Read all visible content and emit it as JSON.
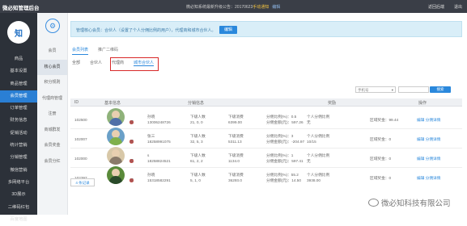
{
  "app": {
    "title": "微必知管理后台"
  },
  "topbar": {
    "message": "微必知系统最新升级公告：20170623",
    "highlight": "手动通知",
    "edit": "编辑",
    "links": [
      "返回后端",
      "退出"
    ]
  },
  "logo_text": "知",
  "nav1": [
    "商品",
    "基本设置",
    "商品管理",
    "会员管理",
    "订单管理",
    "财务信息",
    "促销活动",
    "统计营销",
    "分销管理",
    "微信营销",
    "多网络平台",
    "3D展示",
    "二维码红包",
    "百度地图",
    "支付宝分销"
  ],
  "nav2": [
    "会员",
    "核心会员",
    "积分规则",
    "代理商管理",
    "注册",
    "商城群发",
    "会员奖金",
    "会员分红"
  ],
  "alert": {
    "text": "管理核心会员：合伙人（设置了个人分佣比例的用户），代理商和城市合伙人。",
    "button": "编辑"
  },
  "tabs1": [
    "会员列表",
    "推广二维码"
  ],
  "tabs2": [
    "全部",
    "合伙人",
    "代理商",
    "城市合伙人"
  ],
  "filter": {
    "select": "手机号",
    "button": "搜索"
  },
  "table": {
    "headers": [
      "ID",
      "基本信息",
      "分销信息",
      "奖励",
      "操作"
    ],
    "rows": [
      {
        "id": "102500",
        "name": "孙晓",
        "phone": "13006248726",
        "sub_a": "下级人数",
        "sub_a_val": "21, 0, 0",
        "sub_b": "下级消费",
        "sub_b_val": "6399.00",
        "r1": "分佣比例(%)：0.5",
        "r1b": "个人分佣比例",
        "r2": "分佣金额(元)：597.26",
        "r2b": "无",
        "extra": "区域奖金：99.44",
        "op": "编辑  分佣详情"
      },
      {
        "id": "102007",
        "name": "张三",
        "phone": "18258991075",
        "sub_a": "下级人数",
        "sub_a_val": "32, 5, 3",
        "sub_b": "下级消费",
        "sub_b_val": "5311.13",
        "r1": "分佣比例(%)：3",
        "r1b": "个人分佣比例",
        "r2": "分佣金额(元)：-204.97",
        "r2b": "10/15",
        "extra": "区域奖金：0",
        "op": "编辑  分佣详情"
      },
      {
        "id": "102000",
        "name": "s",
        "phone": "18258824521",
        "sub_a": "下级人数",
        "sub_a_val": "61, 2, 2",
        "sub_b": "下级消费",
        "sub_b_val": "1134.0",
        "r1": "分佣比例(%)：1",
        "r1b": "个人分佣比例",
        "r2": "分佣金额(元)：597.41",
        "r2b": "无",
        "extra": "区域奖金：0",
        "op": "编辑  分佣详情"
      },
      {
        "id": "102397",
        "name": "孙晓",
        "phone": "15318582291",
        "sub_a": "下级人数",
        "sub_a_val": "5, 1, 0",
        "sub_b": "下级消费",
        "sub_b_val": "36293.0",
        "r1": "分佣比例(%)：55.2",
        "r1b": "个人分佣比例",
        "r2": "分佣金额(元)：14.50",
        "r2b": "3938.00",
        "extra": "区域奖金：0",
        "op": "编辑  分佣详情"
      }
    ]
  },
  "pager": "4 条记录",
  "watermark": "微必知科技有限公司"
}
